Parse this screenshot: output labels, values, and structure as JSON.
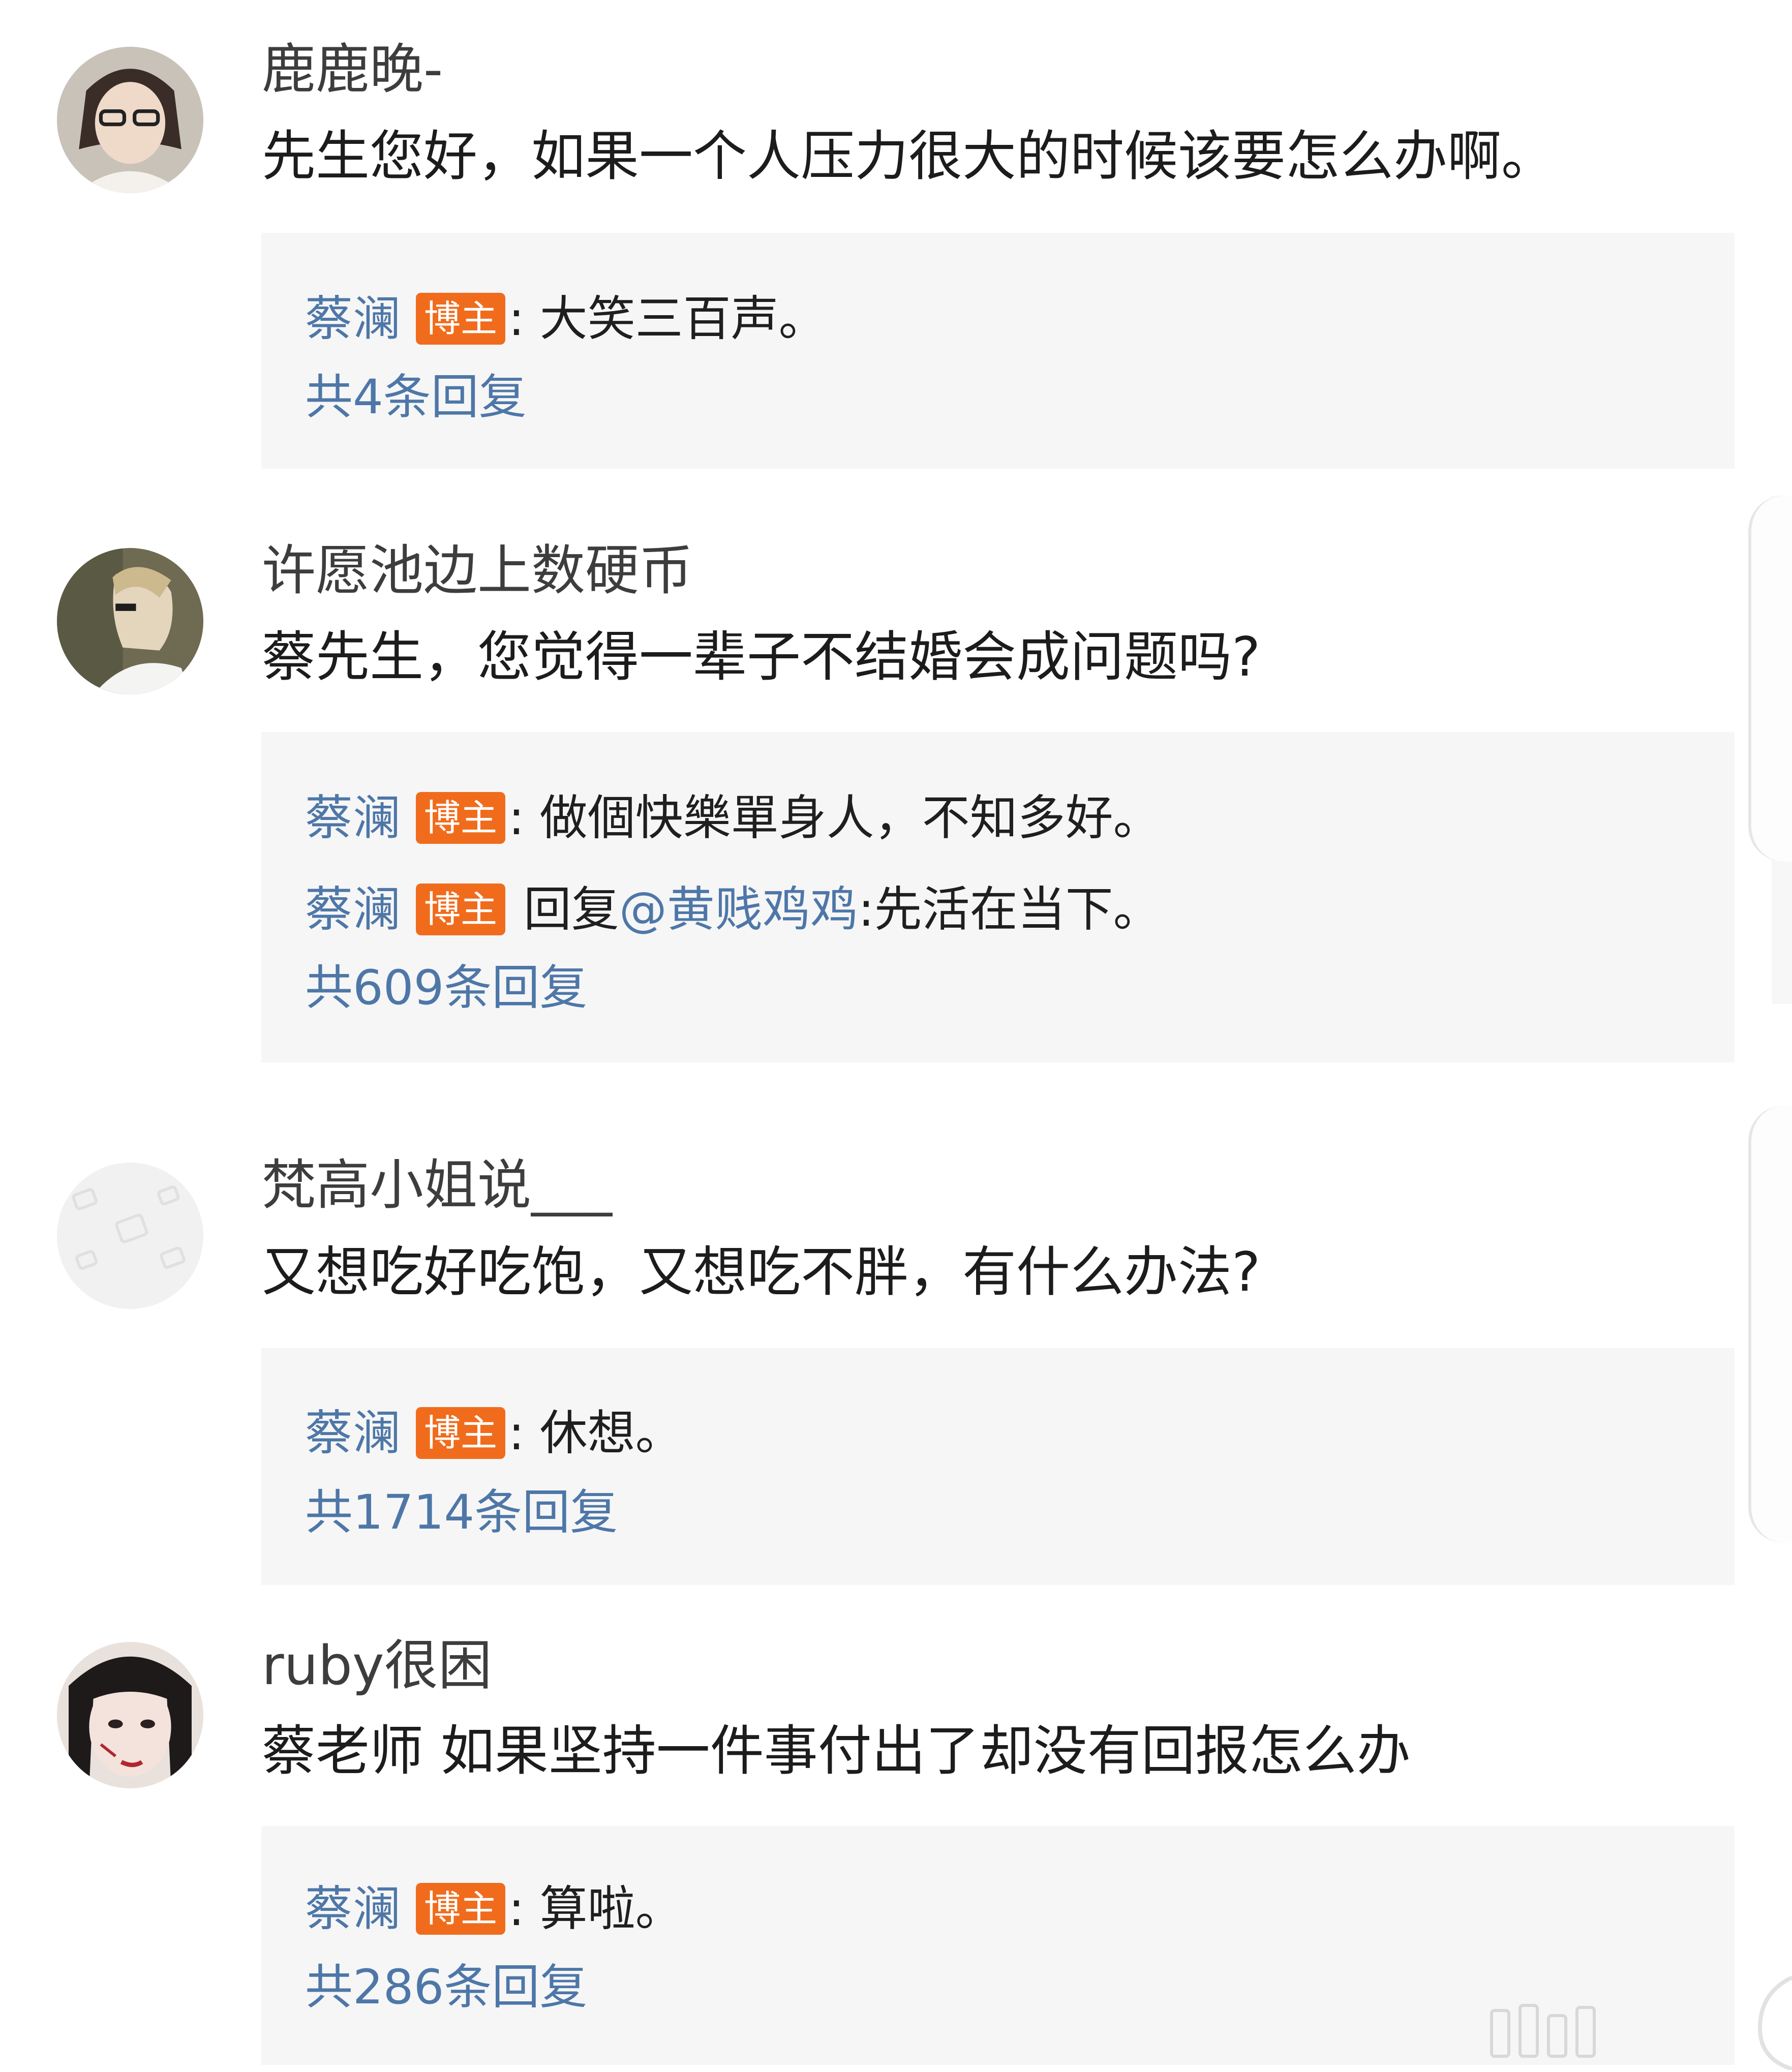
{
  "badge_label": "博主",
  "comments": [
    {
      "username": "鹿鹿晚-",
      "content": "先生您好，如果一个人压力很大的时候该要怎么办啊。",
      "replies": [
        {
          "author": "蔡澜",
          "badge": "博主",
          "prefix": ": ",
          "mention": "",
          "text": "大笑三百声。"
        }
      ],
      "reply_count": "共4条回复"
    },
    {
      "username": "许愿池边上数硬币",
      "content": "蔡先生，您觉得一辈子不结婚会成问题吗?",
      "replies": [
        {
          "author": "蔡澜",
          "badge": "博主",
          "prefix": ": ",
          "mention": "",
          "text": "做個快樂單身人，不知多好。"
        },
        {
          "author": "蔡澜",
          "badge": "博主",
          "prefix": " 回复",
          "mention": "@黄贱鸡鸡",
          "text": ":先活在当下。"
        }
      ],
      "reply_count": "共609条回复"
    },
    {
      "username": "梵高小姐说___",
      "content": "又想吃好吃饱，又想吃不胖，有什么办法?",
      "replies": [
        {
          "author": "蔡澜",
          "badge": "博主",
          "prefix": ": ",
          "mention": "",
          "text": "休想。"
        }
      ],
      "reply_count": "共1714条回复"
    },
    {
      "username": "ruby很困",
      "content": "蔡老师 如果坚持一件事付出了却没有回报怎么办",
      "replies": [
        {
          "author": "蔡澜",
          "badge": "博主",
          "prefix": ": ",
          "mention": "",
          "text": "算啦。"
        }
      ],
      "reply_count": "共286条回复"
    }
  ],
  "colors": {
    "link_blue": "#4e77a8",
    "badge_orange": "#f06c1c",
    "reply_bg": "#f6f6f6"
  }
}
